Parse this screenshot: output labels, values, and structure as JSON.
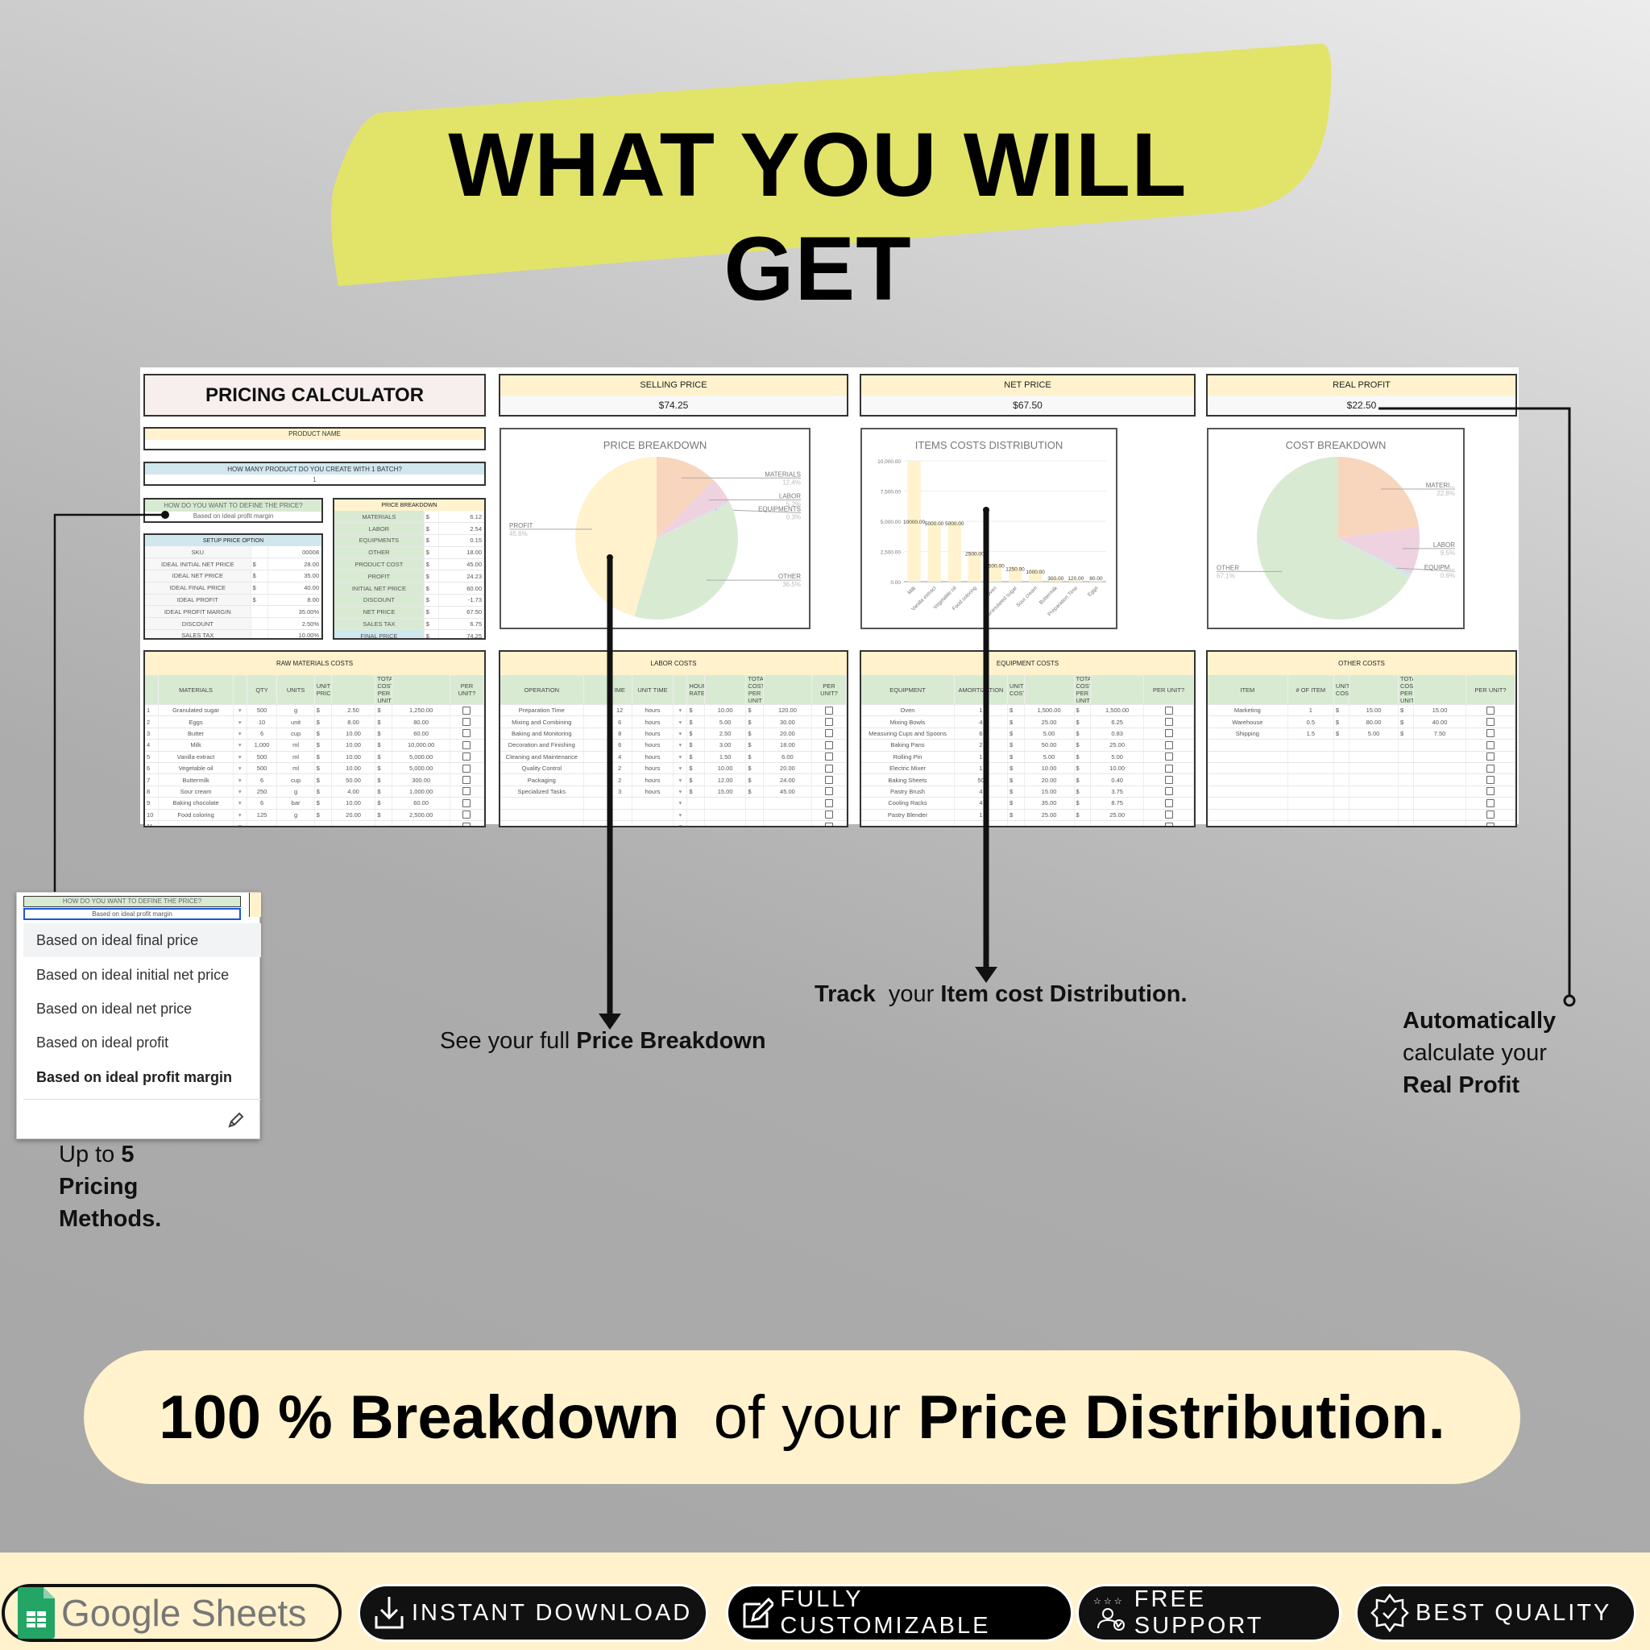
{
  "headline": "WHAT YOU WILL GET",
  "sheet": {
    "calculator_title": "PRICING CALCULATOR",
    "kpis": [
      {
        "label": "SELLING PRICE",
        "value": "$74.25"
      },
      {
        "label": "NET PRICE",
        "value": "$67.50"
      },
      {
        "label": "REAL PROFIT",
        "value": "$22.50"
      }
    ],
    "product_name": {
      "label": "PRODUCT NAME",
      "value": ""
    },
    "batch": {
      "label": "HOW MANY PRODUCT DO YOU CREATE WITH 1 BATCH?",
      "value": "1"
    },
    "define_price": {
      "label": "HOW DO YOU WANT TO DEFINE THE PRICE?",
      "value": "Based on ideal profit margin"
    },
    "setup": {
      "title": "SETUP PRICE OPTION",
      "rows": [
        [
          "SKU",
          "",
          "00008"
        ],
        [
          "IDEAL INITIAL NET PRICE",
          "$",
          "28.00"
        ],
        [
          "IDEAL NET PRICE",
          "$",
          "35.00"
        ],
        [
          "IDEAL FINAL PRICE",
          "$",
          "40.00"
        ],
        [
          "IDEAL PROFIT",
          "$",
          "8.00"
        ],
        [
          "IDEAL PROFIT MARGIN",
          "",
          "35.00%"
        ],
        [
          "DISCOUNT",
          "",
          "2.50%"
        ],
        [
          "SALES TAX",
          "",
          "10.00%"
        ]
      ]
    },
    "price_breakdown": {
      "title": "PRICE BREAKDOWN",
      "rows": [
        [
          "MATERIALS",
          "$",
          "6.12"
        ],
        [
          "LABOR",
          "$",
          "2.54"
        ],
        [
          "EQUIPMENTS",
          "$",
          "0.15"
        ],
        [
          "OTHER",
          "$",
          "18.00"
        ],
        [
          "PRODUCT COST",
          "$",
          "45.00"
        ],
        [
          "PROFIT",
          "$",
          "24.23"
        ],
        [
          "INITIAL NET PRICE",
          "$",
          "60.00"
        ],
        [
          "DISCOUNT",
          "$",
          "-1.73"
        ],
        [
          "NET PRICE",
          "$",
          "67.50"
        ],
        [
          "SALES TAX",
          "$",
          "6.75"
        ],
        [
          "FINAL PRICE",
          "$",
          "74.25"
        ]
      ]
    },
    "tables": [
      {
        "title": "RAW MATERIALS COSTS",
        "headers": [
          "",
          "MATERIALS",
          "",
          "QTY",
          "UNITS",
          "UNIT PRICE",
          "",
          "TOTAL COST PER UNIT",
          "",
          "PER UNIT?"
        ],
        "rows": [
          [
            "1",
            "Granulated sugar",
            "▾",
            "500",
            "g",
            "$",
            "2.50",
            "$",
            "1,250.00",
            ""
          ],
          [
            "2",
            "Eggs",
            "▾",
            "10",
            "unit",
            "$",
            "8.00",
            "$",
            "80.00",
            ""
          ],
          [
            "3",
            "Butter",
            "▾",
            "6",
            "cup",
            "$",
            "10.00",
            "$",
            "60.00",
            ""
          ],
          [
            "4",
            "Milk",
            "▾",
            "1,000",
            "ml",
            "$",
            "10.00",
            "$",
            "10,000.00",
            ""
          ],
          [
            "5",
            "Vanilla extract",
            "▾",
            "500",
            "ml",
            "$",
            "10.00",
            "$",
            "5,000.00",
            ""
          ],
          [
            "6",
            "Vegetable oil",
            "▾",
            "500",
            "ml",
            "$",
            "10.00",
            "$",
            "5,000.00",
            ""
          ],
          [
            "7",
            "Buttermilk",
            "▾",
            "6",
            "cup",
            "$",
            "50.00",
            "$",
            "300.00",
            ""
          ],
          [
            "8",
            "Sour cream",
            "▾",
            "250",
            "g",
            "$",
            "4.00",
            "$",
            "1,000.00",
            ""
          ],
          [
            "9",
            "Baking chocolate",
            "▾",
            "6",
            "bar",
            "$",
            "10.00",
            "$",
            "60.00",
            ""
          ],
          [
            "10",
            "Food coloring",
            "▾",
            "125",
            "g",
            "$",
            "20.00",
            "$",
            "2,500.00",
            ""
          ],
          [
            "11",
            "",
            "▾",
            "",
            "",
            "",
            "",
            "",
            "",
            ""
          ]
        ]
      },
      {
        "title": "LABOR COSTS",
        "headers": [
          "OPERATION",
          "",
          "IME",
          "UNIT TIME",
          "",
          "HOURLY RATE",
          "",
          "TOTAL COST PER UNIT",
          "",
          "PER UNIT?"
        ],
        "rows": [
          [
            "Preparation Time",
            "",
            "12",
            "hours",
            "▾",
            "$",
            "10.00",
            "$",
            "120.00",
            ""
          ],
          [
            "Mixing and Combining",
            "",
            "6",
            "hours",
            "▾",
            "$",
            "5.00",
            "$",
            "30.00",
            ""
          ],
          [
            "Baking and Monitoring",
            "",
            "8",
            "hours",
            "▾",
            "$",
            "2.50",
            "$",
            "20.00",
            ""
          ],
          [
            "Decoration and Finishing",
            "",
            "6",
            "hours",
            "▾",
            "$",
            "3.00",
            "$",
            "18.00",
            ""
          ],
          [
            "Cleaning and Maintenance",
            "",
            "4",
            "hours",
            "▾",
            "$",
            "1.50",
            "$",
            "6.00",
            ""
          ],
          [
            "Quality Control",
            "",
            "2",
            "hours",
            "▾",
            "$",
            "10.00",
            "$",
            "20.00",
            ""
          ],
          [
            "Packaging",
            "",
            "2",
            "hours",
            "▾",
            "$",
            "12.00",
            "$",
            "24.00",
            ""
          ],
          [
            "Specialized Tasks",
            "",
            "3",
            "hours",
            "▾",
            "$",
            "15.00",
            "$",
            "45.00",
            ""
          ],
          [
            "",
            "",
            "",
            "",
            "▾",
            "",
            "",
            "",
            "",
            ""
          ],
          [
            "",
            "",
            "",
            "",
            "▾",
            "",
            "",
            "",
            "",
            ""
          ],
          [
            "",
            "",
            "",
            "",
            "▾",
            "",
            "",
            "",
            "",
            ""
          ]
        ]
      },
      {
        "title": "EQUIPMENT COSTS",
        "headers": [
          "EQUIPMENT",
          "AMORTIZATION",
          "UNIT COST",
          "",
          "TOTAL COST PER UNIT",
          "",
          "PER UNIT?"
        ],
        "rows": [
          [
            "Oven",
            "1",
            "$",
            "1,500.00",
            "$",
            "1,500.00",
            ""
          ],
          [
            "Mixing Bowls",
            "4",
            "$",
            "25.00",
            "$",
            "6.25",
            ""
          ],
          [
            "Measuring Cups and Spoons",
            "6",
            "$",
            "5.00",
            "$",
            "0.83",
            ""
          ],
          [
            "Baking Pans",
            "2",
            "$",
            "50.00",
            "$",
            "25.00",
            ""
          ],
          [
            "Rolling Pin",
            "1",
            "$",
            "5.00",
            "$",
            "5.00",
            ""
          ],
          [
            "Electric Mixer",
            "1",
            "$",
            "10.00",
            "$",
            "10.00",
            ""
          ],
          [
            "Baking Sheets",
            "50",
            "$",
            "20.00",
            "$",
            "0.40",
            ""
          ],
          [
            "Pastry Brush",
            "4",
            "$",
            "15.00",
            "$",
            "3.75",
            ""
          ],
          [
            "Cooling Racks",
            "4",
            "$",
            "35.00",
            "$",
            "8.75",
            ""
          ],
          [
            "Pastry Blender",
            "1",
            "$",
            "25.00",
            "$",
            "25.00",
            ""
          ],
          [
            "",
            "",
            "",
            "",
            "",
            "",
            ""
          ]
        ]
      },
      {
        "title": "OTHER COSTS",
        "headers": [
          "ITEM",
          "# OF ITEM",
          "UNIT COST",
          "",
          "TOTAL COST PER UNIT",
          "",
          "PER UNIT?"
        ],
        "rows": [
          [
            "Marketing",
            "1",
            "$",
            "15.00",
            "$",
            "15.00",
            ""
          ],
          [
            "Warehouse",
            "0.5",
            "$",
            "80.00",
            "$",
            "40.00",
            ""
          ],
          [
            "Shipping",
            "1.5",
            "$",
            "5.00",
            "$",
            "7.50",
            ""
          ],
          [
            "",
            "",
            "",
            "",
            "",
            "",
            ""
          ],
          [
            "",
            "",
            "",
            "",
            "",
            "",
            ""
          ],
          [
            "",
            "",
            "",
            "",
            "",
            "",
            ""
          ],
          [
            "",
            "",
            "",
            "",
            "",
            "",
            ""
          ],
          [
            "",
            "",
            "",
            "",
            "",
            "",
            ""
          ],
          [
            "",
            "",
            "",
            "",
            "",
            "",
            ""
          ],
          [
            "",
            "",
            "",
            "",
            "",
            "",
            ""
          ],
          [
            "",
            "",
            "",
            "",
            "",
            "",
            ""
          ]
        ]
      }
    ]
  },
  "chart_data": [
    {
      "type": "pie",
      "title": "PRICE BREAKDOWN",
      "slices": [
        {
          "label": "MATERIALS",
          "value": 12.4,
          "display": "12.4%",
          "color": "#f8d5bd"
        },
        {
          "label": "LABOR",
          "value": 5.2,
          "display": "5.2%",
          "color": "#eed2e0"
        },
        {
          "label": "EQUIPMENTS",
          "value": 0.3,
          "display": "0.3%",
          "color": "#cfe6ee"
        },
        {
          "label": "OTHER",
          "value": 36.5,
          "display": "36.5%",
          "color": "#d9ead3"
        },
        {
          "label": "PROFIT",
          "value": 45.6,
          "display": "45.6%",
          "color": "#fff2cc"
        }
      ]
    },
    {
      "type": "bar",
      "title": "ITEMS COSTS DISTRIBUTION",
      "categories": [
        "Milk",
        "Vanilla extract",
        "Vegetable oil",
        "Food coloring",
        "Oven",
        "Granulated sugar",
        "Sour cream",
        "Buttermilk",
        "Preparation Time",
        "Eggs"
      ],
      "values": [
        10000,
        5000,
        5000,
        2500,
        1500,
        1250,
        1000,
        300,
        120,
        80
      ],
      "data_labels": [
        "10000.00",
        "5000.00",
        "5000.00",
        "2500.00",
        "1500.00",
        "1250.00",
        "1000.00",
        "300.00",
        "120.00",
        "80.00"
      ],
      "yticks": [
        "0.00",
        "2,500.00",
        "5,000.00",
        "7,500.00",
        "10,000.00"
      ],
      "ylim": [
        0,
        10000
      ],
      "grid": true,
      "color": "#fff2cc"
    },
    {
      "type": "pie",
      "title": "COST BREAKDOWN",
      "slices": [
        {
          "label": "MATERI...",
          "value": 22.8,
          "display": "22.8%",
          "color": "#f8d5bd"
        },
        {
          "label": "LABOR",
          "value": 9.5,
          "display": "9.5%",
          "color": "#eed2e0"
        },
        {
          "label": "EQUIPM...",
          "value": 0.6,
          "display": "0.6%",
          "color": "#cfe6ee"
        },
        {
          "label": "OTHER",
          "value": 67.1,
          "display": "67.1%",
          "color": "#d9ead3"
        }
      ]
    }
  ],
  "dropdown": {
    "header": "HOW DO YOU WANT TO DEFINE THE PRICE?",
    "selected": "Based on ideal profit margin",
    "options": [
      "Based on ideal final price",
      "Based on ideal initial net price",
      "Based on ideal net price",
      "Based on ideal profit",
      "Based on ideal profit margin"
    ],
    "edit_icon": "pencil-icon"
  },
  "captions": {
    "methods": {
      "a": "Up to ",
      "b": "5",
      "c": "Pricing",
      "d": "Methods."
    },
    "breakdown": {
      "a": "See your full ",
      "b": "Price Breakdown"
    },
    "track": {
      "a": "Track",
      "b": "  your ",
      "c": "Item cost Distribution."
    },
    "profit": {
      "a": "Automatically",
      "b": "calculate your",
      "c": "Real Profit"
    }
  },
  "statement": {
    "a": "100 % Breakdown",
    "b": "  of your ",
    "c": "Price Distribution."
  },
  "badges": {
    "sheets": "Google Sheets",
    "download": "INSTANT DOWNLOAD",
    "custom": "FULLY CUSTOMIZABLE",
    "support": "FREE SUPPORT",
    "quality": "BEST QUALITY"
  },
  "colors": {
    "banner": "#e2e46a",
    "cream": "#fff2cc",
    "green": "#d9ead3",
    "blue": "#d0e7ee"
  }
}
